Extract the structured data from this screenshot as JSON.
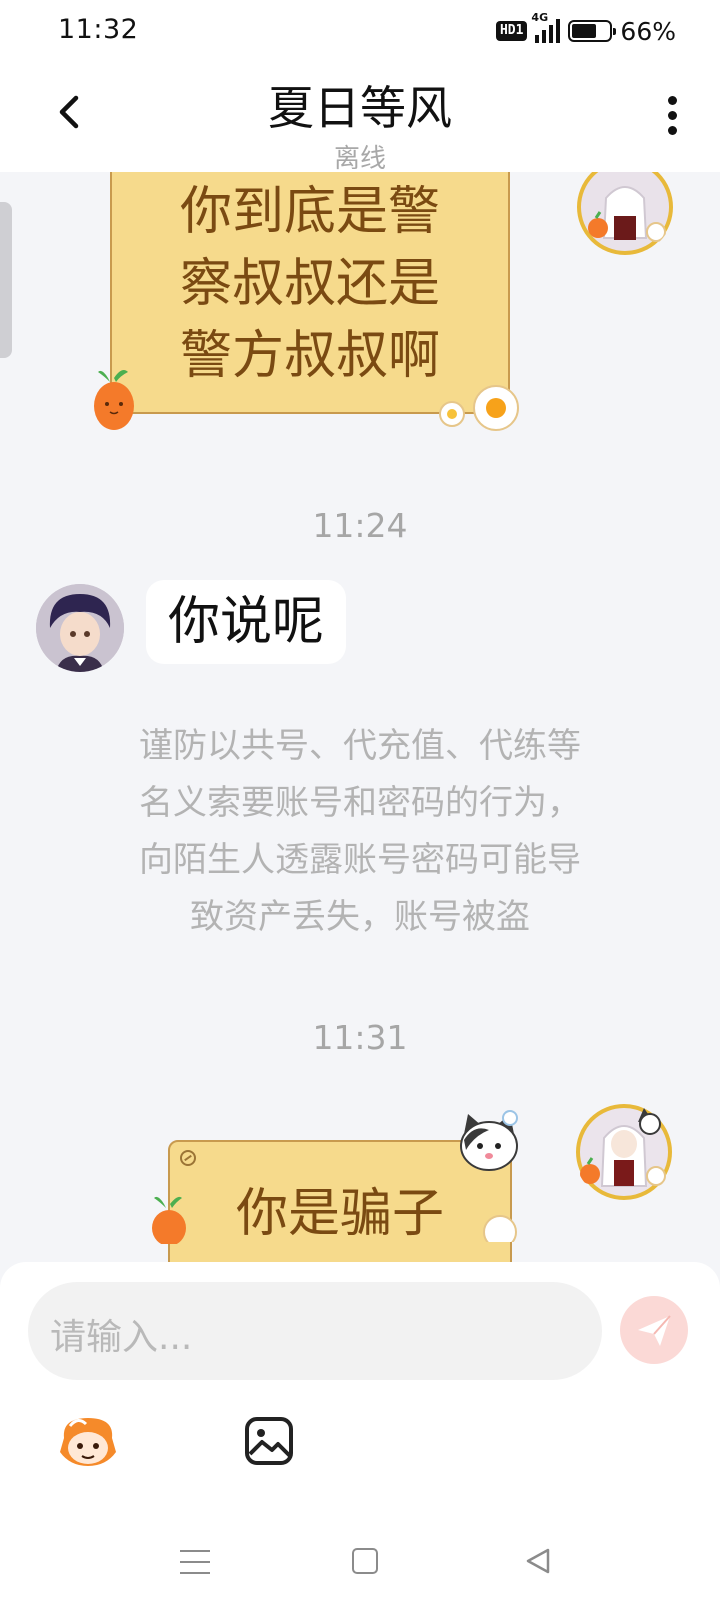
{
  "status_bar": {
    "time": "11:32",
    "hd_label": "HD1",
    "network_label": "4G",
    "battery_percent": "66%",
    "battery_level": 0.66
  },
  "header": {
    "title": "夏日等风",
    "status": "离线",
    "back_icon": "chevron-left-icon",
    "more_icon": "vertical-dots-icon"
  },
  "messages": [
    {
      "side": "right",
      "style": "note",
      "text_lines": [
        "你到底是警",
        "察叔叔还是",
        "警方叔叔啊"
      ]
    },
    {
      "type": "timestamp",
      "text": "11:24"
    },
    {
      "side": "left",
      "style": "plain",
      "text": "你说呢"
    },
    {
      "type": "system",
      "text_lines": [
        "谨防以共号、代充值、代练等",
        "名义索要账号和密码的行为，",
        "向陌生人透露账号密码可能导",
        "致资产丢失，账号被盗"
      ]
    },
    {
      "type": "timestamp",
      "text": "11:31"
    },
    {
      "side": "right",
      "style": "note",
      "text": "你是骗子"
    }
  ],
  "input": {
    "placeholder": "请输入...",
    "send_icon": "send-icon"
  },
  "toolbar": {
    "emoji_icon": "emoji-character-icon",
    "image_icon": "image-icon"
  },
  "nav": {
    "menu_icon": "menu-icon",
    "home_icon": "home-icon",
    "back_icon": "back-triangle-icon"
  },
  "colors": {
    "note_bg": "#f6da8c",
    "note_text": "#7a4a12",
    "background": "#f4f5f8",
    "send_bg": "#fbd9d6"
  }
}
